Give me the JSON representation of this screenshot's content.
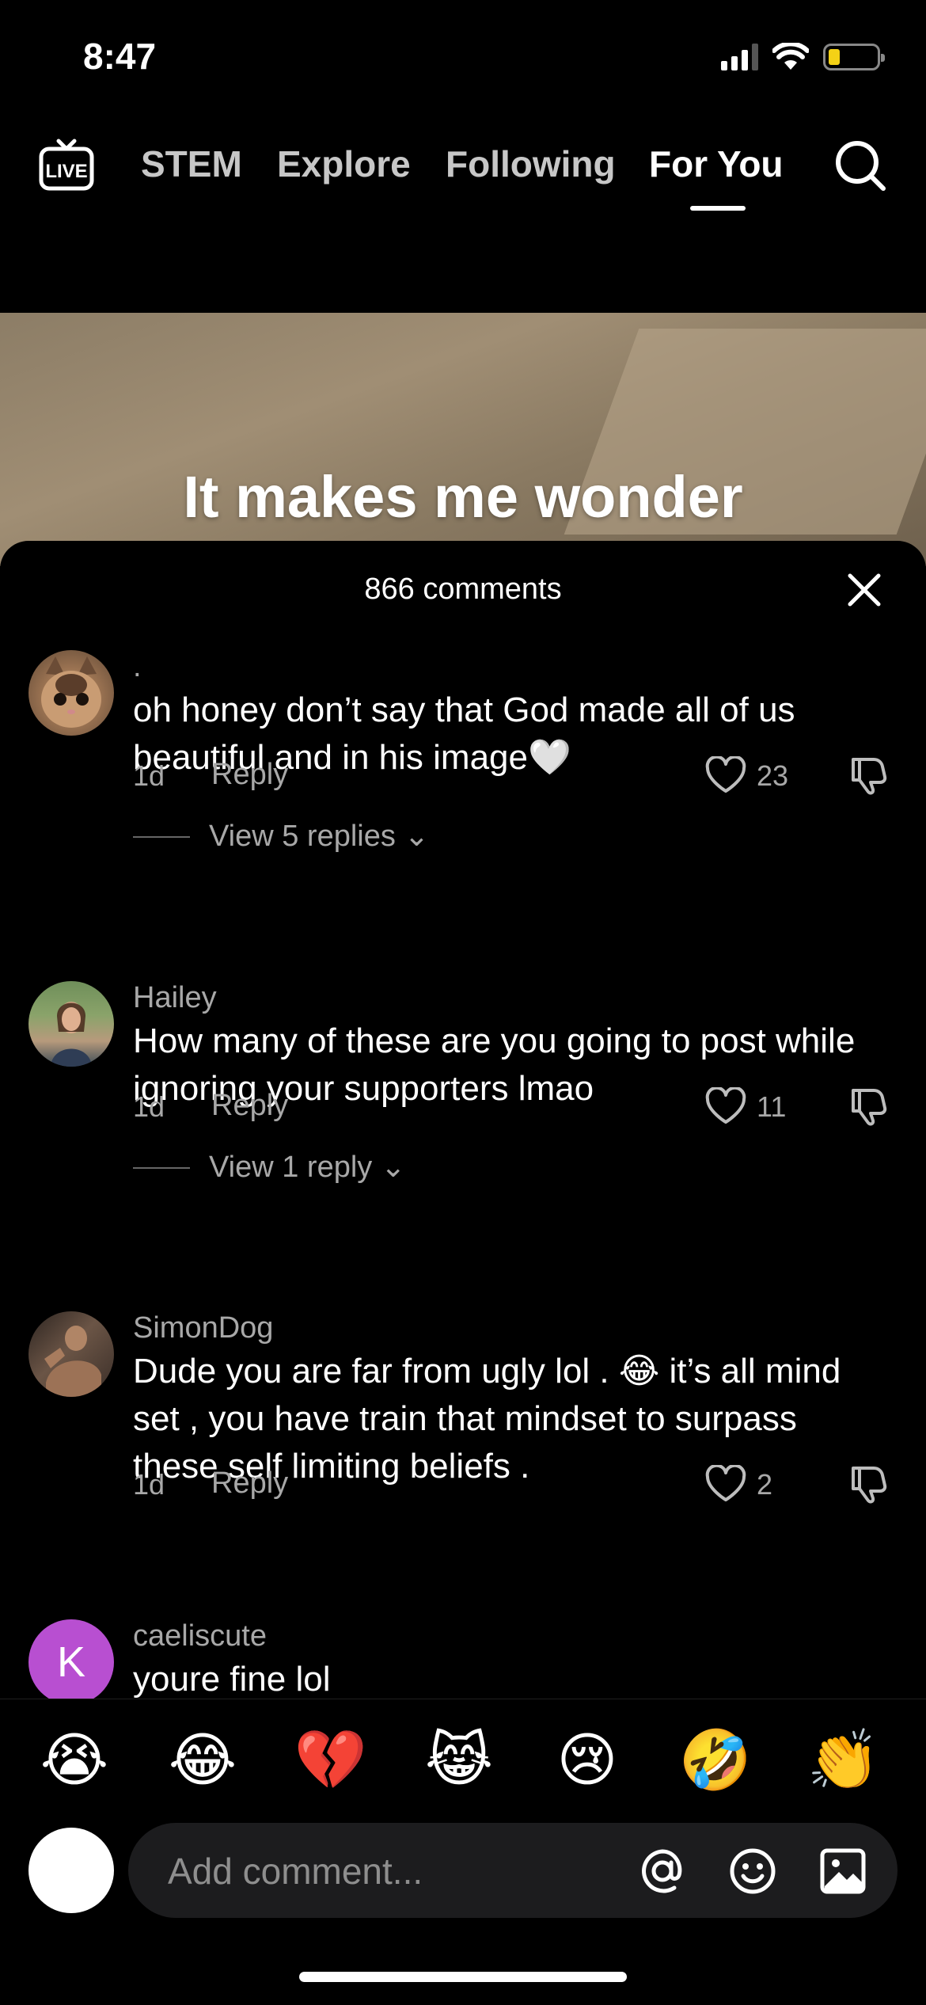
{
  "status_bar": {
    "time": "8:47"
  },
  "top_nav": {
    "live_label": "LIVE",
    "tabs": [
      {
        "label": "STEM",
        "active": false
      },
      {
        "label": "Explore",
        "active": false
      },
      {
        "label": "Following",
        "active": false
      },
      {
        "label": "For You",
        "active": true
      }
    ]
  },
  "video": {
    "caption": "It makes me wonder"
  },
  "comments_sheet": {
    "title": "866 comments",
    "comments": [
      {
        "username": ".",
        "text": "oh honey don’t say that God made all of us beautiful and in his image🤍",
        "time": "1d",
        "reply_label": "Reply",
        "likes": "23",
        "view_replies": "View 5 replies"
      },
      {
        "username": "Hailey",
        "text": "How many of these are you going to post while ignoring your supporters lmao",
        "time": "1d",
        "reply_label": "Reply",
        "likes": "11",
        "view_replies": "View 1 reply"
      },
      {
        "username": "SimonDog",
        "text": "Dude you are far from ugly lol . 😂 it’s all mind set , you have train that mindset to surpass these self limiting beliefs .",
        "time": "1d",
        "reply_label": "Reply",
        "likes": "2"
      },
      {
        "username": "caeliscute",
        "avatar_letter": "K",
        "text": "youre fine lol"
      }
    ]
  },
  "emoji_bar": [
    "😭",
    "😂",
    "💔",
    "😹",
    "😢",
    "🤣",
    "👏"
  ],
  "comment_input": {
    "placeholder": "Add comment..."
  },
  "colors": {
    "background": "#000000",
    "secondary_text": "#a8a8a8",
    "input_bg": "#1c1c1e",
    "k_avatar": "#b84fd1"
  }
}
